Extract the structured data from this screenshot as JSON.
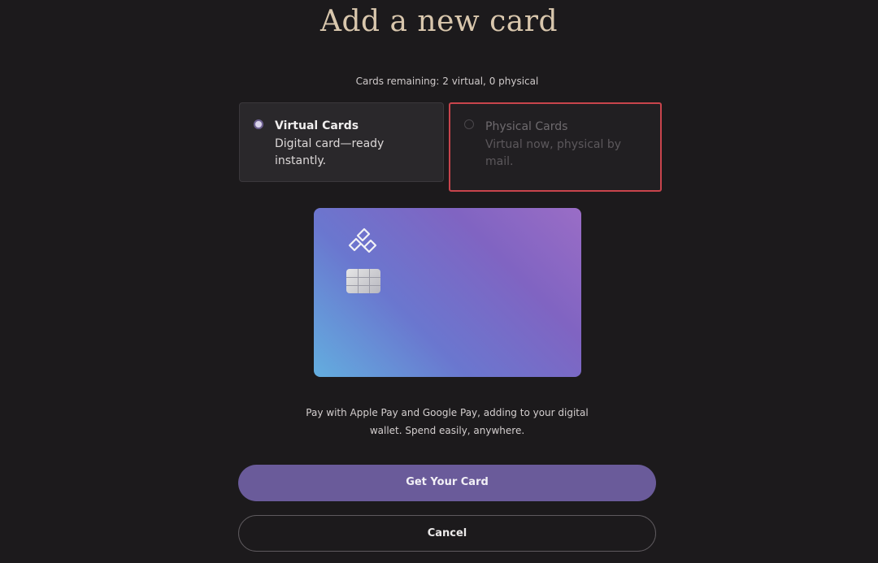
{
  "page": {
    "title": "Add a new card",
    "remaining": "Cards remaining: 2 virtual, 0 physical"
  },
  "options": {
    "virtual": {
      "title": "Virtual Cards",
      "description": "Digital card—ready instantly.",
      "selected": true
    },
    "physical": {
      "title": "Physical Cards",
      "description": "Virtual now, physical by mail.",
      "selected": false
    }
  },
  "card_preview": {
    "logo_icon": "card-brand-logo-icon",
    "chip_icon": "card-chip-icon"
  },
  "description": {
    "line1": "Pay with Apple Pay and Google Pay, adding to your digital",
    "line2": "wallet. Spend easily, anywhere."
  },
  "actions": {
    "primary_label": "Get Your Card",
    "cancel_label": "Cancel"
  },
  "colors": {
    "background": "#1c1a1c",
    "accent": "#6a5b9a",
    "title": "#d9c7ad",
    "highlight_border": "#c8444c"
  }
}
